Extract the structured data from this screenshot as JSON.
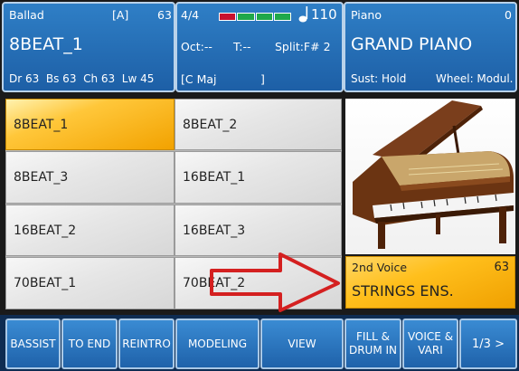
{
  "style_panel": {
    "style_category": "Ballad",
    "variation": "[A]",
    "tempo_value_left": "63",
    "style_name": "8BEAT_1",
    "channel_info": "Dr 63  Bs 63  Ch 63  Lw 45"
  },
  "center_panel": {
    "time_signature": "4/4",
    "tempo": "110",
    "octave": "Oct:--",
    "transpose": "T:--",
    "split": "Split:F# 2",
    "chord": "[C Maj",
    "chord_close": "]"
  },
  "voice_panel": {
    "category": "Piano",
    "number": "0",
    "voice_name": "GRAND PIANO",
    "sustain": "Sust: Hold",
    "wheel": "Wheel: Modul."
  },
  "style_grid": [
    {
      "label": "8BEAT_1",
      "selected": true
    },
    {
      "label": "8BEAT_2",
      "selected": false
    },
    {
      "label": "8BEAT_3",
      "selected": false
    },
    {
      "label": "16BEAT_1",
      "selected": false
    },
    {
      "label": "16BEAT_2",
      "selected": false
    },
    {
      "label": "16BEAT_3",
      "selected": false
    },
    {
      "label": "70BEAT_1",
      "selected": false
    },
    {
      "label": "70BEAT_2",
      "selected": false
    }
  ],
  "second_voice": {
    "label": "2nd Voice",
    "number": "63",
    "name": "STRINGS ENS."
  },
  "bottom_buttons": [
    {
      "label": "BASSIST"
    },
    {
      "label": "TO END"
    },
    {
      "label": "REINTRO"
    },
    {
      "label": "MODELING"
    },
    {
      "label": "VIEW"
    },
    {
      "label": "FILL &\nDRUM IN"
    },
    {
      "label": "VOICE &\nVARI"
    },
    {
      "label": "1/3 >"
    }
  ],
  "colors": {
    "panel_blue": "#1d5fa6",
    "selected_orange": "#f2a200",
    "arrow_red": "#d42020",
    "level_red": "#c8102e",
    "level_green": "#1fa84a"
  }
}
